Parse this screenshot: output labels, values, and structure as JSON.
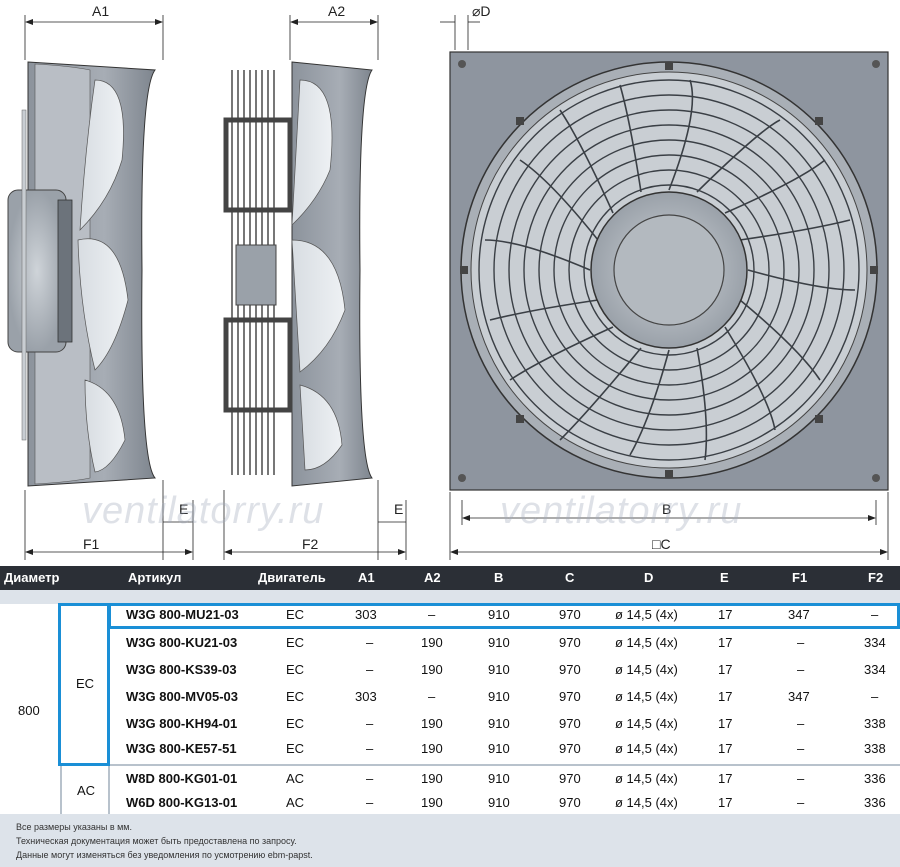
{
  "drawing": {
    "labels": {
      "a1": "A1",
      "a2": "A2",
      "d": "⌀D",
      "b": "B",
      "c": "□C",
      "e1": "E",
      "e2": "E",
      "f1": "F1",
      "f2": "F2"
    },
    "watermark": "ventilatorry.ru"
  },
  "table": {
    "headers": [
      "Диаметр",
      "Артикул",
      "Двигатель",
      "A1",
      "A2",
      "B",
      "C",
      "D",
      "E",
      "F1",
      "F2"
    ],
    "diameter": "800",
    "groups": [
      {
        "motor": "EC",
        "rows": [
          {
            "article": "W3G 800-MU21-03",
            "motor": "EC",
            "a1": "303",
            "a2": "–",
            "b": "910",
            "c": "970",
            "d": "ø 14,5 (4x)",
            "e": "17",
            "f1": "347",
            "f2": "–"
          },
          {
            "article": "W3G 800-KU21-03",
            "motor": "EC",
            "a1": "–",
            "a2": "190",
            "b": "910",
            "c": "970",
            "d": "ø 14,5 (4x)",
            "e": "17",
            "f1": "–",
            "f2": "334"
          },
          {
            "article": "W3G 800-KS39-03",
            "motor": "EC",
            "a1": "–",
            "a2": "190",
            "b": "910",
            "c": "970",
            "d": "ø 14,5 (4x)",
            "e": "17",
            "f1": "–",
            "f2": "334"
          },
          {
            "article": "W3G 800-MV05-03",
            "motor": "EC",
            "a1": "303",
            "a2": "–",
            "b": "910",
            "c": "970",
            "d": "ø 14,5 (4x)",
            "e": "17",
            "f1": "347",
            "f2": "–"
          },
          {
            "article": "W3G 800-KH94-01",
            "motor": "EC",
            "a1": "–",
            "a2": "190",
            "b": "910",
            "c": "970",
            "d": "ø 14,5 (4x)",
            "e": "17",
            "f1": "–",
            "f2": "338"
          },
          {
            "article": "W3G 800-KE57-51",
            "motor": "EC",
            "a1": "–",
            "a2": "190",
            "b": "910",
            "c": "970",
            "d": "ø 14,5 (4x)",
            "e": "17",
            "f1": "–",
            "f2": "338"
          }
        ]
      },
      {
        "motor": "AC",
        "rows": [
          {
            "article": "W8D 800-KG01-01",
            "motor": "AC",
            "a1": "–",
            "a2": "190",
            "b": "910",
            "c": "970",
            "d": "ø 14,5 (4x)",
            "e": "17",
            "f1": "–",
            "f2": "336"
          },
          {
            "article": "W6D 800-KG13-01",
            "motor": "AC",
            "a1": "–",
            "a2": "190",
            "b": "910",
            "c": "970",
            "d": "ø 14,5 (4x)",
            "e": "17",
            "f1": "–",
            "f2": "336"
          }
        ]
      }
    ]
  },
  "notes": [
    "Все размеры указаны в мм.",
    "Техническая документация  может быть предоставлена по запросу.",
    "Данные могут изменяться без уведомления по усмотрению ebm-papst."
  ],
  "colors": {
    "header_bg": "#2b2f36",
    "subbar_bg": "#dde3ea",
    "highlight": "#1a8fd6",
    "plate": "#8e959f"
  }
}
